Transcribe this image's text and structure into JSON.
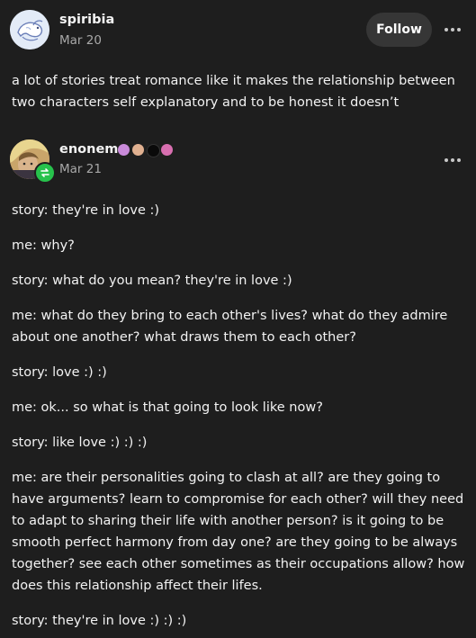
{
  "original_post": {
    "username": "spiribia",
    "date": "Mar 20",
    "follow_label": "Follow",
    "text": "a lot of stories treat romance like it makes the relationship between two characters self explanatory and to be honest it doesn’t"
  },
  "reblog": {
    "username": "enonem",
    "date": "Mar 21",
    "badges": [
      "badge-icon",
      "badge-icon",
      "badge-icon",
      "badge-icon"
    ],
    "lines": [
      "story: they're in love :)",
      "me: why?",
      "story: what do you mean? they're in love :)",
      "me: what do they bring to each other's lives? what do they admire about one another? what draws them to each other?",
      "story: love :) :)",
      "me: ok... so what is that going to look like now?",
      "story: like love :) :) :)",
      "me: are their personalities going to clash at all? are they going to have arguments? learn to compromise for each other? will they need to adapt to sharing their life with another person? is it going to be smooth perfect harmony from day one? are they going to be always together? see each other sometimes as their occupations allow? how does this relationship affect their lifes.",
      "story: they're in love :) :) :)"
    ]
  },
  "colors": {
    "background": "#1e1e1e",
    "follow_button": "#363636",
    "reblog_badge": "#27c24c",
    "muted_text": "#a8a8a8"
  }
}
